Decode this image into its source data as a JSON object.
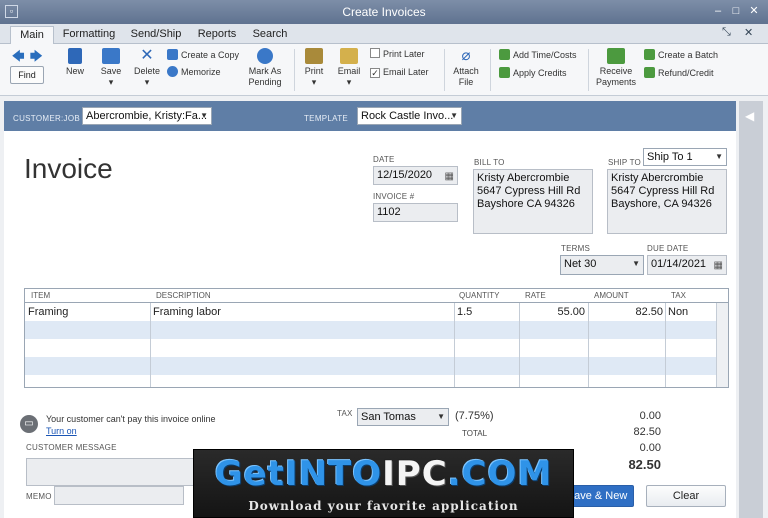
{
  "window": {
    "title": "Create Invoices"
  },
  "tabs": [
    "Main",
    "Formatting",
    "Send/Ship",
    "Reports",
    "Search"
  ],
  "ribbon": {
    "find": "Find",
    "new": "New",
    "save": "Save",
    "delete": "Delete",
    "create_copy": "Create a Copy",
    "memorize": "Memorize",
    "mark_as_pending": "Mark As Pending",
    "print": "Print",
    "email": "Email",
    "print_later": "Print Later",
    "email_later": "Email Later",
    "attach_file": "Attach File",
    "add_time_costs": "Add Time/Costs",
    "apply_credits": "Apply Credits",
    "receive_payments": "Receive Payments",
    "create_batch": "Create a Batch",
    "refund_credit": "Refund/Credit"
  },
  "header": {
    "customer_job_label": "CUSTOMER:JOB",
    "customer_job_value": "Abercrombie, Kristy:Fa...",
    "template_label": "TEMPLATE",
    "template_value": "Rock Castle Invo..."
  },
  "invoice": {
    "title": "Invoice",
    "date_label": "DATE",
    "date": "12/15/2020",
    "invoice_num_label": "INVOICE #",
    "invoice_num": "1102",
    "bill_to_label": "BILL TO",
    "bill_to": [
      "Kristy Abercrombie",
      "5647 Cypress Hill Rd",
      "Bayshore CA 94326"
    ],
    "ship_to_label": "SHIP TO",
    "ship_to_select": "Ship To 1",
    "ship_to": [
      "Kristy Abercrombie",
      "5647 Cypress Hill Rd",
      "Bayshore, CA 94326"
    ],
    "terms_label": "TERMS",
    "terms": "Net 30",
    "due_date_label": "DUE DATE",
    "due_date": "01/14/2021"
  },
  "items_table": {
    "columns": [
      "ITEM",
      "DESCRIPTION",
      "QUANTITY",
      "RATE",
      "AMOUNT",
      "TAX"
    ],
    "rows": [
      {
        "item": "Framing",
        "description": "Framing labor",
        "quantity": "1.5",
        "rate": "55.00",
        "amount": "82.50",
        "tax": "Non"
      }
    ]
  },
  "footer": {
    "online_pay_text": "Your customer can't pay this invoice online",
    "turn_on": "Turn on",
    "customer_message_label": "CUSTOMER MESSAGE",
    "memo_label": "MEMO",
    "tax_label": "TAX",
    "tax_item": "San Tomas",
    "tax_rate": "(7.75%)",
    "tax_amount": "0.00",
    "total_label": "TOTAL",
    "total": "82.50",
    "payments_applied": "0.00",
    "balance_due": "82.50",
    "save_new": "Save & New",
    "clear": "Clear"
  },
  "watermark": {
    "brand": [
      "GetINTO",
      "IPC",
      ".COM"
    ],
    "tagline": "Download your favorite application"
  }
}
